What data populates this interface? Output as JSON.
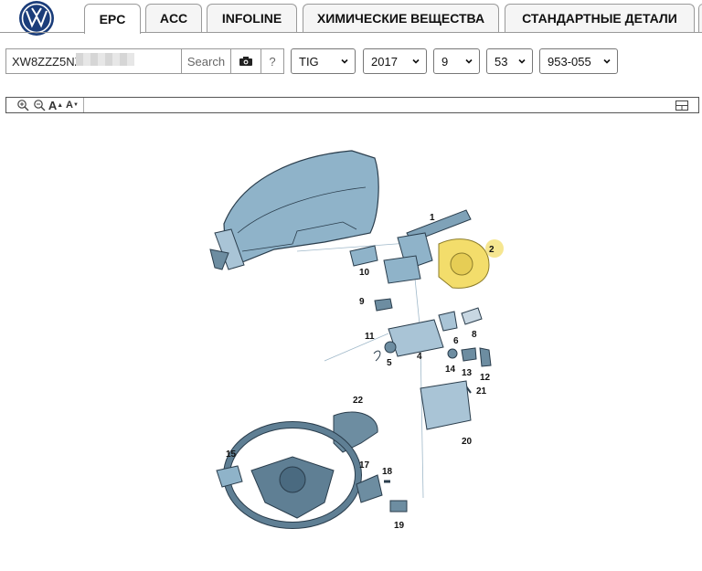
{
  "brand": {
    "logo_icon": "volkswagen-logo-icon",
    "logo_color": "#1b3d7a"
  },
  "tabs": [
    {
      "label": "EPC",
      "active": true
    },
    {
      "label": "ACC",
      "active": false
    },
    {
      "label": "INFOLINE",
      "active": false
    },
    {
      "label": "ХИМИЧЕСКИЕ ВЕЩЕСТВА",
      "active": false
    },
    {
      "label": "СТАНДАРТНЫЕ ДЕТАЛИ",
      "active": false
    }
  ],
  "search": {
    "vin_value": "XW8ZZZ5NZ",
    "search_label": "Search",
    "camera_icon": "camera-icon",
    "help_label": "?"
  },
  "filters": {
    "model": "TIG",
    "year": "2017",
    "main_group": "9",
    "sub_group": "53",
    "illustration": "953-055"
  },
  "toolbar": {
    "zoom_in_icon": "zoom-in-icon",
    "zoom_out_icon": "zoom-out-icon",
    "font_larger_label": "A",
    "font_smaller_label": "A",
    "layout_icon": "layout-toggle-icon"
  },
  "diagram": {
    "highlight_color": "#f3dd6b",
    "callouts": [
      "1",
      "2",
      "4",
      "5",
      "6",
      "8",
      "9",
      "10",
      "11",
      "12",
      "13",
      "14",
      "15",
      "17",
      "18",
      "19",
      "20",
      "21",
      "22"
    ]
  }
}
